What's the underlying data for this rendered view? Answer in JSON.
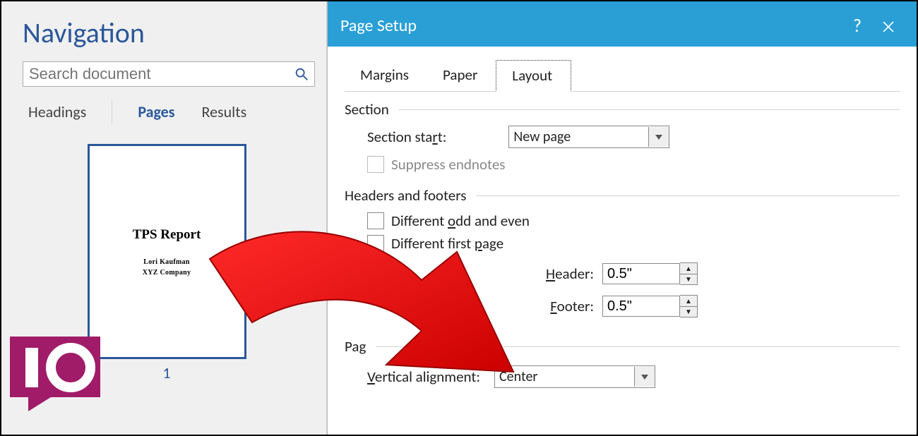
{
  "navigation": {
    "title": "Navigation",
    "search_placeholder": "Search document",
    "tabs": {
      "headings": "Headings",
      "pages": "Pages",
      "results": "Results"
    },
    "thumbnail": {
      "title_line": "TPS Report",
      "author_line": "Lori Kaufman",
      "company_line": "XYZ Company",
      "page_number": "1"
    }
  },
  "dialog": {
    "title": "Page Setup",
    "help": "?",
    "tabs": {
      "margins": "Margins",
      "paper": "Paper",
      "layout": "Layout"
    },
    "section": {
      "group": "Section",
      "start_label_pre": "Section sta",
      "start_label_u": "r",
      "start_label_post": "t:",
      "start_value": "New page",
      "suppress_label": "Suppress endnotes"
    },
    "headers_footers": {
      "group": "Headers and footers",
      "odd_even_pre": "Different ",
      "odd_even_u": "o",
      "odd_even_post": "dd and even",
      "first_pre": "Different first ",
      "first_u": "p",
      "first_post": "age",
      "header_u": "H",
      "header_post": "eader:",
      "footer_u": "F",
      "footer_post": "ooter:",
      "header_value": "0.5\"",
      "footer_value": "0.5\""
    },
    "page": {
      "group_partial": "Pag",
      "valign_u": "V",
      "valign_post": "ertical alignment:",
      "valign_value": "Center"
    }
  }
}
